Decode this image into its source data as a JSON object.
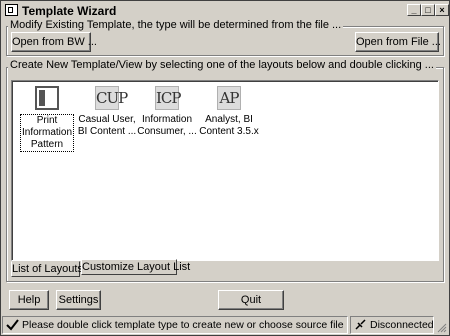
{
  "window": {
    "title": "Template Wizard"
  },
  "title_buttons": {
    "minimize": "_",
    "maximize": "□",
    "close": "×"
  },
  "modify": {
    "label": "Modify Existing Template, the type will be determined from the file ...",
    "open_bw": "Open from BW ...",
    "open_file": "Open from File ..."
  },
  "create": {
    "label": "Create New Template/View by selecting one of the layouts below and double clicking ...",
    "items": [
      {
        "icon_text": "",
        "label_lines": [
          "Print",
          "Information",
          "Pattern"
        ]
      },
      {
        "icon_text": "CUP",
        "label_lines": [
          "Casual User,",
          "BI Content ..."
        ]
      },
      {
        "icon_text": "ICP",
        "label_lines": [
          "Information",
          "Consumer, ..."
        ]
      },
      {
        "icon_text": "AP",
        "label_lines": [
          "Analyst, BI",
          "Content 3.5.x"
        ]
      }
    ],
    "tabs": [
      "List of Layouts",
      "Customize Layout List"
    ]
  },
  "buttons": {
    "help": "Help",
    "settings": "Settings",
    "quit": "Quit"
  },
  "status": {
    "message": "Please double click template type to create new or choose source file",
    "connection": "Disconnected"
  }
}
